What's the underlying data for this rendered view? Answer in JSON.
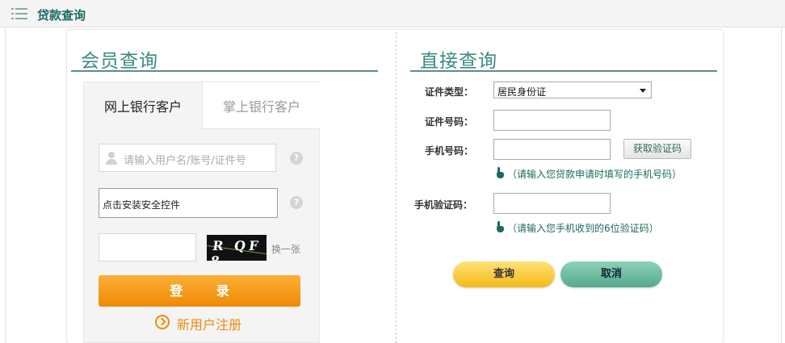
{
  "header": {
    "title": "贷款查询",
    "icon": "list-icon"
  },
  "member_query": {
    "title": "会员查询",
    "tabs": [
      {
        "label": "网上银行客户",
        "active": true
      },
      {
        "label": "掌上银行客户",
        "active": false
      }
    ],
    "username_placeholder": "请输入用户名/账号/证件号",
    "plugin_text": "点击安装安全控件",
    "help_glyph": "?",
    "captcha_text": "R QF 8",
    "refresh_label": "换一张",
    "login_label": "登 录",
    "register_label": "新用户注册"
  },
  "direct_query": {
    "title": "直接查询",
    "id_type_label": "证件类型：",
    "id_type_value": "居民身份证",
    "id_number_label": "证件号码：",
    "phone_label": "手机号码：",
    "get_code_label": "获取验证码",
    "phone_hint": "（请输入您贷款申请时填写的手机号码）",
    "code_label": "手机验证码：",
    "code_hint": "（请输入您手机收到的6位验证码）",
    "query_label": "查询",
    "cancel_label": "取消"
  },
  "colors": {
    "brand_green": "#3a8a83",
    "accent_orange": "#f08a05",
    "query_yellow": "#f4b918",
    "cancel_green": "#56a98d"
  }
}
